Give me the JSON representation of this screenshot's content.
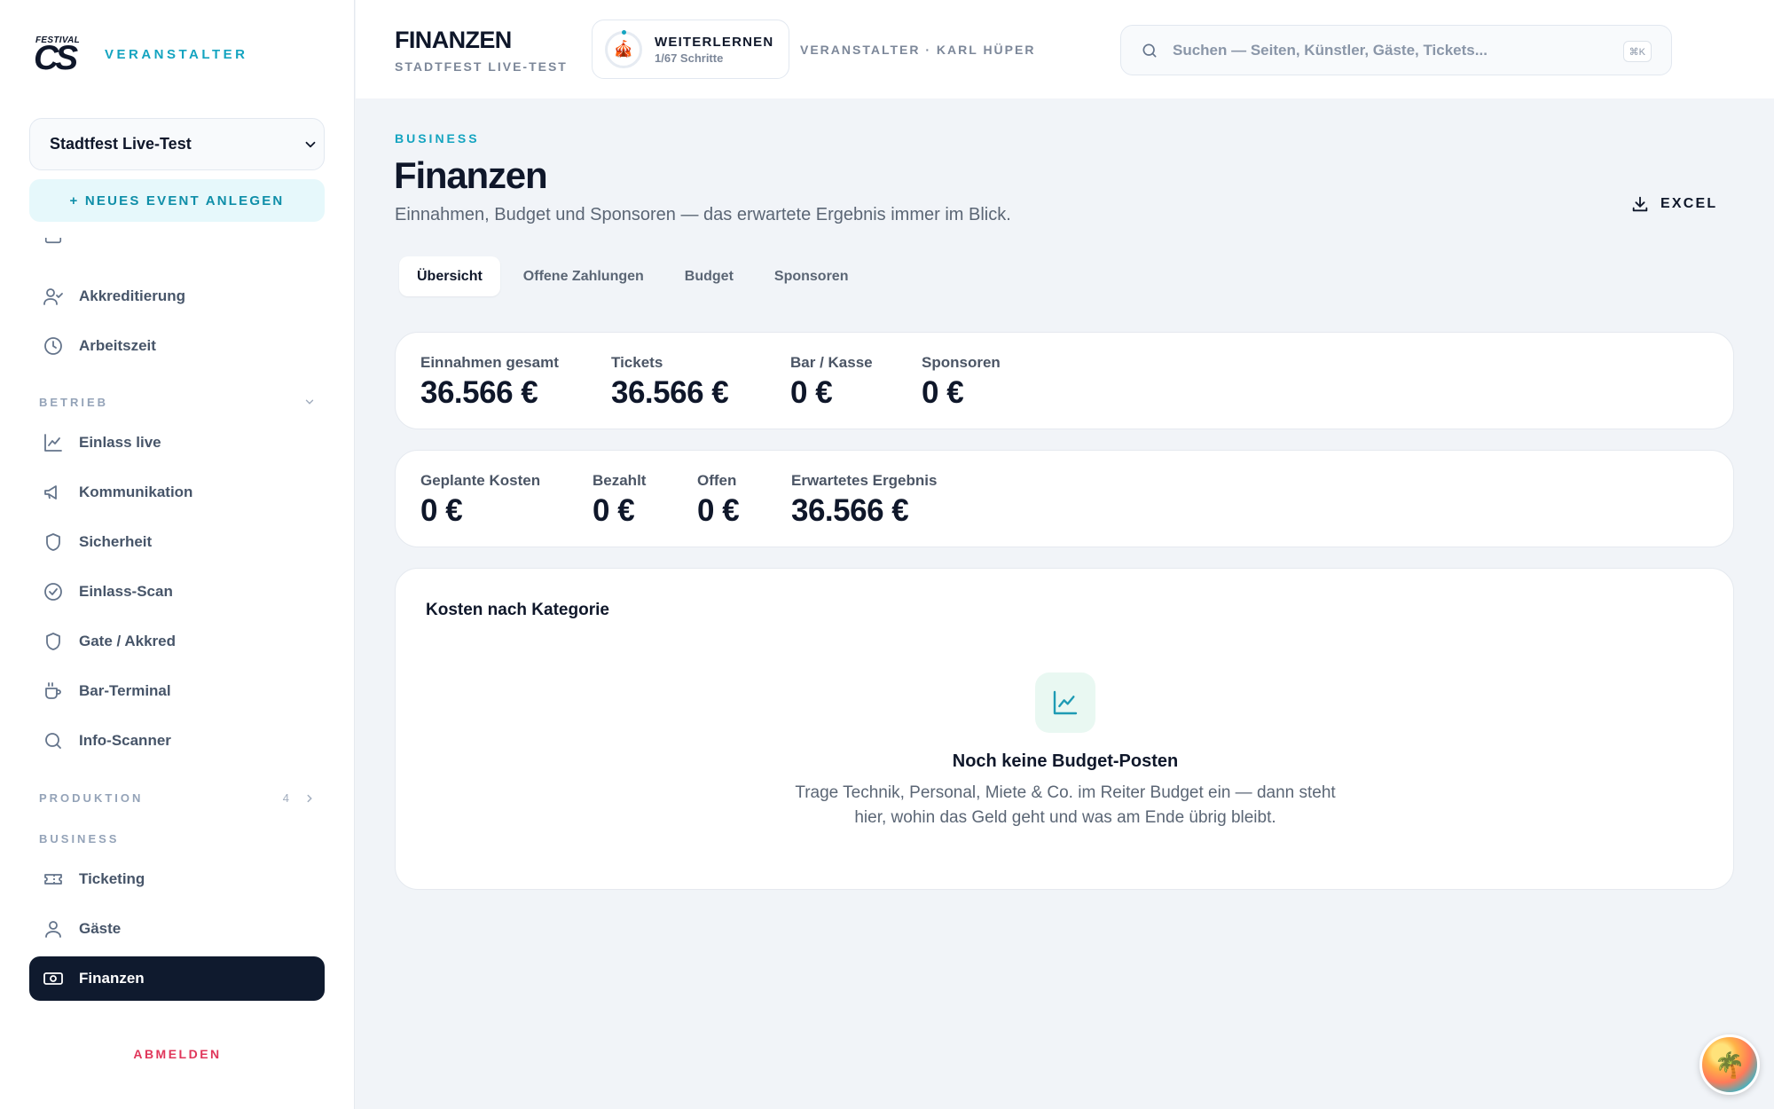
{
  "app": {
    "logo_top": "FESTIVAL",
    "logo_main": "CS",
    "role": "VERANSTALTER",
    "logout": "ABMELDEN"
  },
  "sidebar": {
    "event_select": {
      "value": "Stadtfest Live-Test"
    },
    "new_event": "+ NEUES EVENT ANLEGEN",
    "top_items": [
      {
        "label": "Akkreditierung",
        "icon": "user-check-icon"
      },
      {
        "label": "Arbeitszeit",
        "icon": "clock-icon"
      }
    ],
    "sections": {
      "betrieb": {
        "label": "BETRIEB",
        "items": [
          {
            "label": "Einlass live",
            "icon": "line-chart-icon"
          },
          {
            "label": "Kommunikation",
            "icon": "megaphone-icon"
          },
          {
            "label": "Sicherheit",
            "icon": "shield-icon"
          },
          {
            "label": "Einlass-Scan",
            "icon": "check-circle-icon"
          },
          {
            "label": "Gate / Akkred",
            "icon": "shield-icon"
          },
          {
            "label": "Bar-Terminal",
            "icon": "coffee-cup-icon"
          },
          {
            "label": "Info-Scanner",
            "icon": "search-icon"
          }
        ]
      },
      "produktion": {
        "label": "PRODUKTION",
        "count": "4"
      },
      "business": {
        "label": "BUSINESS",
        "items": [
          {
            "label": "Ticketing",
            "icon": "ticket-icon"
          },
          {
            "label": "Gäste",
            "icon": "user-icon"
          },
          {
            "label": "Finanzen",
            "icon": "banknote-icon",
            "active": true
          }
        ]
      }
    }
  },
  "topbar": {
    "title": "FINANZEN",
    "subtitle": "STADTFEST LIVE-TEST",
    "learn": {
      "title": "WEITERLERNEN",
      "progress": "1/67 Schritte",
      "icon": "circus-tent-icon"
    },
    "org": "VERANSTALTER · KARL HÜPER",
    "search": {
      "placeholder": "Suchen — Seiten, Künstler, Gäste, Tickets...",
      "shortcut": "⌘K"
    }
  },
  "main": {
    "eyebrow": "BUSINESS",
    "title": "Finanzen",
    "subtitle": "Einnahmen, Budget und Sponsoren — das erwartete Ergebnis immer im Blick.",
    "excel": "EXCEL",
    "tabs": [
      "Übersicht",
      "Offene Zahlungen",
      "Budget",
      "Sponsoren"
    ],
    "income": [
      {
        "label": "Einnahmen gesamt",
        "value": "36.566 €"
      },
      {
        "label": "Tickets",
        "value": "36.566 €"
      },
      {
        "label": "Bar / Kasse",
        "value": "0 €"
      },
      {
        "label": "Sponsoren",
        "value": "0 €"
      }
    ],
    "costs": [
      {
        "label": "Geplante Kosten",
        "value": "0 €"
      },
      {
        "label": "Bezahlt",
        "value": "0 €"
      },
      {
        "label": "Offen",
        "value": "0 €"
      },
      {
        "label": "Erwartetes Ergebnis",
        "value": "36.566 €"
      }
    ],
    "categories": {
      "title": "Kosten nach Kategorie",
      "empty_title": "Noch keine Budget-Posten",
      "empty_text": "Trage Technik, Personal, Miete & Co. im Reiter Budget ein — dann steht hier, wohin das Geld geht und was am Ende übrig bleibt."
    }
  },
  "colors": {
    "accent": "#14a4c0",
    "active_nav": "#0f1a2e",
    "logout": "#e0365a",
    "empty_icon_bg": "#e9f8f2"
  }
}
